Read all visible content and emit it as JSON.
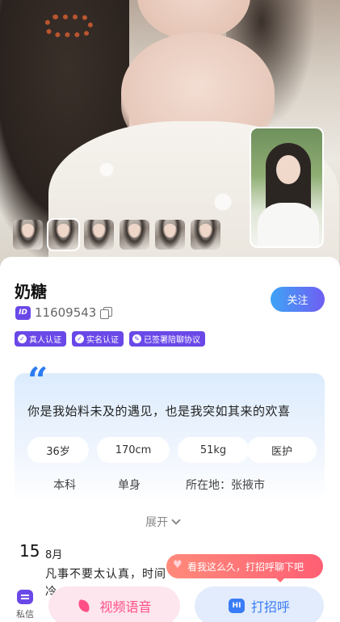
{
  "profile": {
    "name": "奶糖",
    "id_badge": "ID",
    "id_number": "11609543",
    "follow_label": "关注",
    "tags": [
      {
        "icon": "✓",
        "label": "真人认证"
      },
      {
        "icon": "✓",
        "label": "实名认证"
      },
      {
        "icon": "✎",
        "label": "已签署陪聊协议"
      }
    ]
  },
  "bio": {
    "quote_mark": "“",
    "text": "你是我始料未及的遇见，也是我突如其来的欢喜",
    "chips": [
      "36岁",
      "170cm",
      "51kg",
      "医护"
    ],
    "info": [
      "本科",
      "单身",
      "所在地：张掖市"
    ],
    "expand_label": "展开"
  },
  "moment": {
    "day": "15",
    "month": "8月",
    "text": "凡事不要太认真，时间冷……"
  },
  "greeting_bubble": "看我这么久，打招呼聊下吧",
  "bottom": {
    "pm_label": "私信",
    "video_label": "视频语音",
    "greet_badge": "HI",
    "greet_label": "打招呼"
  },
  "colors": {
    "accent_purple": "#6a48e8",
    "accent_blue": "#3a7cf5",
    "accent_pink": "#ff4f86"
  }
}
